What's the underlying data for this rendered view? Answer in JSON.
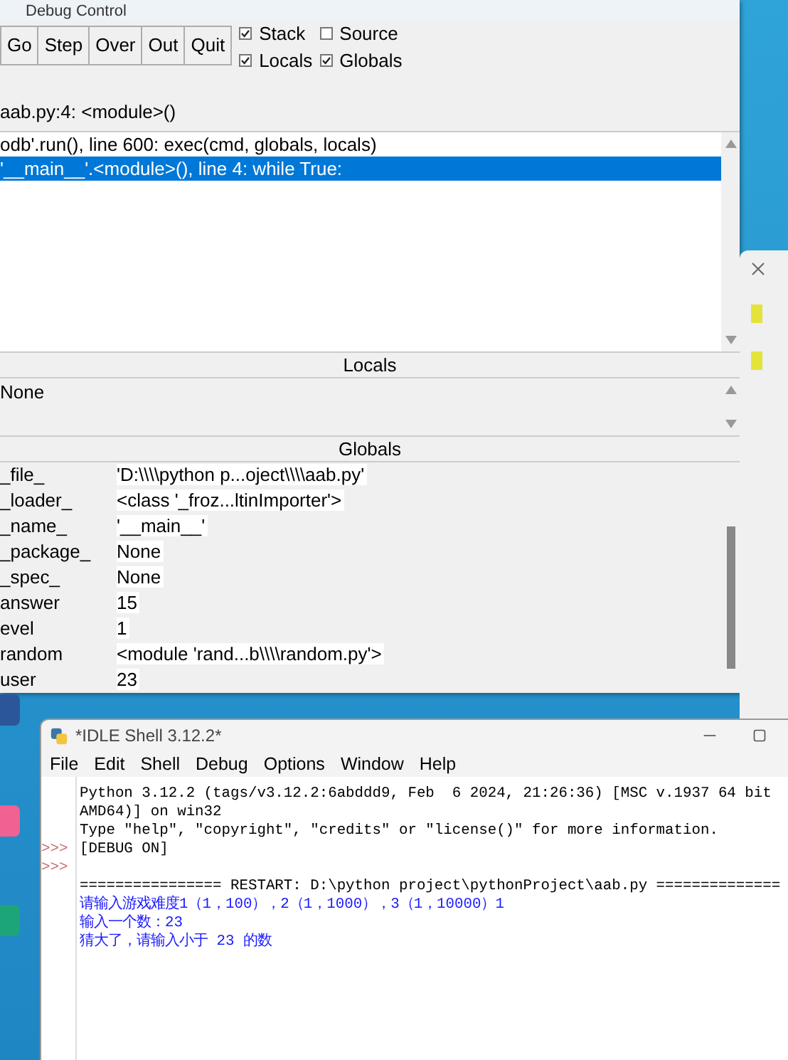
{
  "debug_window": {
    "title": "Debug Control",
    "buttons": [
      "Go",
      "Step",
      "Over",
      "Out",
      "Quit"
    ],
    "options": [
      {
        "label": "Stack",
        "checked": true
      },
      {
        "label": "Source",
        "checked": false
      },
      {
        "label": "Locals",
        "checked": true
      },
      {
        "label": "Globals",
        "checked": true
      }
    ],
    "status": "aab.py:4: <module>()",
    "stack": [
      {
        "text": "odb'.run(), line 600: exec(cmd, globals, locals)",
        "selected": false
      },
      {
        "text": "'__main__'.<module>(), line 4: while True:",
        "selected": true
      }
    ],
    "locals": {
      "title": "Locals",
      "rows": [
        {
          "name": "None"
        }
      ]
    },
    "globals": {
      "title": "Globals",
      "rows": [
        {
          "name": "_file_",
          "value": "'D:\\\\\\\\python p...oject\\\\\\\\aab.py'"
        },
        {
          "name": "_loader_",
          "value": "<class '_froz...ltinImporter'>"
        },
        {
          "name": "_name_",
          "value": "'__main__'"
        },
        {
          "name": "_package_",
          "value": "None"
        },
        {
          "name": "_spec_",
          "value": "None"
        },
        {
          "name": "answer",
          "value": "15"
        },
        {
          "name": "evel",
          "value": "1"
        },
        {
          "name": "random",
          "value": "<module 'rand...b\\\\\\\\random.py'>"
        },
        {
          "name": "user",
          "value": "23"
        }
      ]
    }
  },
  "shell_window": {
    "title": "*IDLE Shell 3.12.2*",
    "menu": [
      "File",
      "Edit",
      "Shell",
      "Debug",
      "Options",
      "Window",
      "Help"
    ],
    "lines": [
      {
        "kind": "info",
        "text": "Python 3.12.2 (tags/v3.12.2:6abddd9, Feb  6 2024, 21:26:36) [MSC v.1937 64 bit"
      },
      {
        "kind": "info",
        "text": "AMD64)] on win32"
      },
      {
        "kind": "info",
        "text": "Type \"help\", \"copyright\", \"credits\" or \"license()\" for more information."
      },
      {
        "kind": "info",
        "prompt": ">>>",
        "text": "[DEBUG ON]"
      },
      {
        "prompt": ">>>"
      },
      {
        "kind": "info",
        "text": "================ RESTART: D:\\python project\\pythonProject\\aab.py =============="
      },
      {
        "kind": "stdout",
        "text": "请输入游戏难度1（1，100），2（1，1000），3（1，10000）1"
      },
      {
        "kind": "stdout",
        "text": "输入一个数：23"
      },
      {
        "kind": "stdout",
        "text": "猜大了，请输入小于 23 的数"
      }
    ]
  }
}
